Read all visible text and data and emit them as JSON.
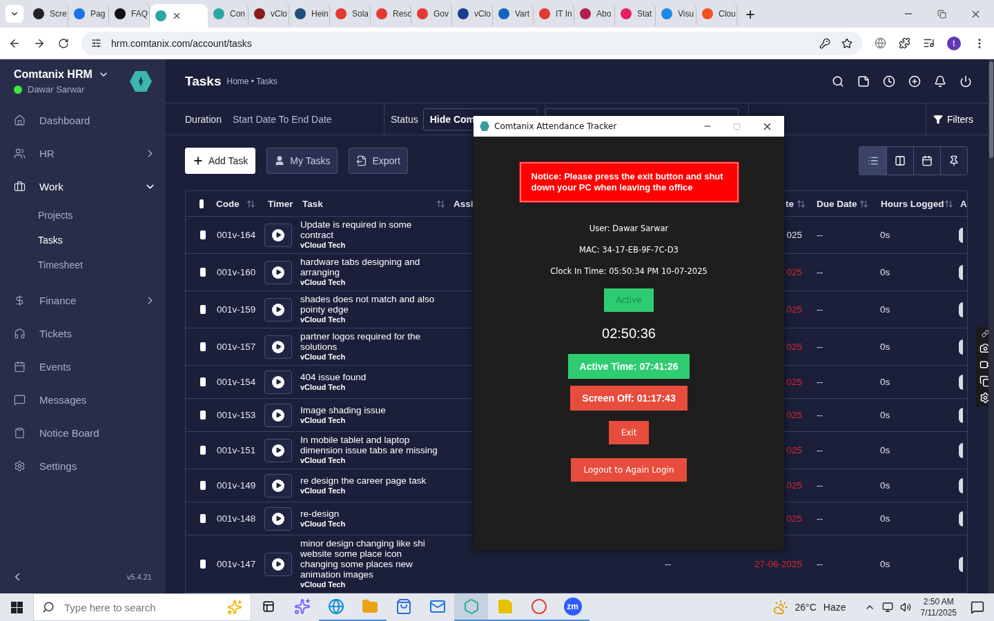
{
  "browser": {
    "tabs": [
      {
        "label": "Scre",
        "color": "#222222",
        "selected": false
      },
      {
        "label": "Pag",
        "color": "#1a73e8",
        "selected": false
      },
      {
        "label": "FAQ",
        "color": "#111111",
        "selected": false
      },
      {
        "color": "#2aa7a0",
        "selected": true
      },
      {
        "label": "Con",
        "color": "#2aa7a0",
        "selected": false
      },
      {
        "label": "vClo",
        "color": "#8b1a1a",
        "selected": false
      },
      {
        "label": "Hein",
        "color": "#1f4e79",
        "selected": false
      },
      {
        "label": "Sola",
        "color": "#e53935",
        "selected": false
      },
      {
        "label": "Resc",
        "color": "#e53935",
        "selected": false
      },
      {
        "label": "Gov",
        "color": "#e53935",
        "selected": false
      },
      {
        "label": "vClo",
        "color": "#1a3d8f",
        "selected": false
      },
      {
        "label": "Vart",
        "color": "#1565c0",
        "selected": false
      },
      {
        "label": "IT In",
        "color": "#e53935",
        "selected": false
      },
      {
        "label": "Abo",
        "color": "#b0204f",
        "selected": false
      },
      {
        "label": "Stat",
        "color": "#e91e63",
        "selected": false
      },
      {
        "label": "Visu",
        "color": "#1e88e5",
        "selected": false
      },
      {
        "label": "Clou",
        "color": "#f4511e",
        "selected": false
      }
    ],
    "url": "hrm.comtanix.com/account/tasks",
    "profile": "t"
  },
  "sidebar": {
    "brand": "Comtanix HRM",
    "user": "Dawar Sarwar",
    "online": true,
    "items": [
      {
        "label": "Dashboard",
        "kind": "link",
        "selected": false
      },
      {
        "label": "HR",
        "kind": "group",
        "expanded": false
      },
      {
        "label": "Work",
        "kind": "group",
        "expanded": true,
        "children": [
          {
            "label": "Projects",
            "selected": false
          },
          {
            "label": "Tasks",
            "selected": true
          },
          {
            "label": "Timesheet",
            "selected": false
          }
        ]
      },
      {
        "label": "Finance",
        "kind": "group",
        "expanded": false
      },
      {
        "label": "Tickets",
        "kind": "link",
        "selected": false
      },
      {
        "label": "Events",
        "kind": "link",
        "selected": false
      },
      {
        "label": "Messages",
        "kind": "link",
        "selected": false
      },
      {
        "label": "Notice Board",
        "kind": "link",
        "selected": false
      },
      {
        "label": "Settings",
        "kind": "link",
        "selected": false
      }
    ],
    "version": "v5.4.21"
  },
  "header": {
    "title": "Tasks",
    "breadcrumb": "Home • Tasks"
  },
  "filters": {
    "duration_label": "Duration",
    "duration_value": "Start Date To End Date",
    "status_label": "Status",
    "status_value": "Hide Com",
    "filters_button": "Filters"
  },
  "toolbar": {
    "buttons": [
      {
        "label": "Add Task",
        "kind": "primary"
      },
      {
        "label": "My Tasks",
        "kind": "user"
      },
      {
        "label": "Export",
        "kind": "export"
      }
    ],
    "views": [
      {
        "selected": true
      },
      {
        "selected": false
      },
      {
        "selected": false
      },
      {
        "selected": false
      }
    ]
  },
  "table": {
    "select_all_checked": false,
    "columns": [
      {
        "label": "Code",
        "sortable": true
      },
      {
        "label": "Timer",
        "sortable": false
      },
      {
        "label": "Task",
        "sortable": true
      },
      {
        "label": "Assi"
      },
      {
        "label": "te",
        "sortable": true
      },
      {
        "label": "Due Date",
        "sortable": true
      },
      {
        "label": "Hours Logged",
        "sortable": true
      },
      {
        "label": "A"
      }
    ],
    "rows": [
      {
        "checked": false,
        "code": "001v-164",
        "task": "Update is required in some contract",
        "project": "vCloud Tech",
        "start_date": "025",
        "overdue": false,
        "due_date": "--",
        "hours": "0s"
      },
      {
        "checked": false,
        "code": "001v-160",
        "task": "hardware tabs designing and arranging",
        "project": "vCloud Tech",
        "start_date": "025",
        "overdue": true,
        "due_date": "--",
        "hours": "0s"
      },
      {
        "checked": false,
        "code": "001v-159",
        "task": "shades does not match and also pointy edge",
        "project": "vCloud Tech",
        "start_date": "025",
        "overdue": true,
        "due_date": "--",
        "hours": "0s"
      },
      {
        "checked": false,
        "code": "001v-157",
        "task": "partner logos required for the solutions",
        "project": "vCloud Tech",
        "start_date": "025",
        "overdue": true,
        "due_date": "--",
        "hours": "0s"
      },
      {
        "checked": false,
        "code": "001v-154",
        "task": "404 issue found",
        "project": "vCloud Tech",
        "start_date": "025",
        "overdue": true,
        "due_date": "--",
        "hours": "0s"
      },
      {
        "checked": false,
        "code": "001v-153",
        "task": "Image shading issue",
        "project": "vCloud Tech",
        "start_date": "025",
        "overdue": true,
        "due_date": "--",
        "hours": "0s"
      },
      {
        "checked": false,
        "code": "001v-151",
        "task": "In mobile tablet and laptop dimension issue tabs are missing",
        "project": "vCloud Tech",
        "start_date": "025",
        "overdue": true,
        "due_date": "--",
        "hours": "0s"
      },
      {
        "checked": false,
        "code": "001v-149",
        "task": "re design the career page task",
        "project": "vCloud Tech",
        "start_date": "025",
        "overdue": true,
        "due_date": "--",
        "hours": "0s"
      },
      {
        "checked": false,
        "code": "001v-148",
        "task": "re-design",
        "project": "vCloud Tech",
        "start_date": "025",
        "overdue": true,
        "due_date": "--",
        "hours": "0s"
      },
      {
        "checked": false,
        "code": "001v-147",
        "task": "minor design changing like shi website some place icon changing some places new animation images",
        "project": "vCloud Tech",
        "column_6": "--",
        "start_date": "27-06-2025",
        "overdue": true,
        "due_date": "--",
        "hours": "0s"
      }
    ]
  },
  "dialog": {
    "title": "Comtanix Attendance Tracker",
    "notice": "Notice: Please press the exit button and shut down your PC when leaving the office",
    "user": "User: Dawar Sarwar",
    "mac": "MAC: 34-17-EB-9F-7C-D3",
    "clock_in": "Clock In Time: 05:50:34 PM 10-07-2025",
    "status": {
      "label": "Active",
      "disabled": true
    },
    "elapsed": "02:50:36",
    "active_time": "Active Time: 07:41:26",
    "screen_off": "Screen Off: 01:17:43",
    "exit": "Exit",
    "logout": "Logout to Again Login"
  },
  "taskbar": {
    "search_placeholder": "Type here to search",
    "apps": [
      {
        "kind": "sparkles",
        "selected": false,
        "running": false
      },
      {
        "kind": "globe",
        "selected": false,
        "running": true
      },
      {
        "kind": "folder",
        "selected": false,
        "running": true
      },
      {
        "kind": "store",
        "selected": false,
        "running": false
      },
      {
        "kind": "mail",
        "selected": false,
        "running": false
      },
      {
        "kind": "hexagon",
        "selected": true,
        "running": true
      },
      {
        "kind": "note",
        "selected": false,
        "running": true
      },
      {
        "kind": "circle",
        "selected": false,
        "running": true
      },
      {
        "kind": "zoom",
        "label": "zm",
        "selected": false,
        "running": true
      }
    ],
    "temperature": "26°C",
    "weather": "Haze",
    "time": "2:50 AM",
    "date": "7/11/2025"
  }
}
